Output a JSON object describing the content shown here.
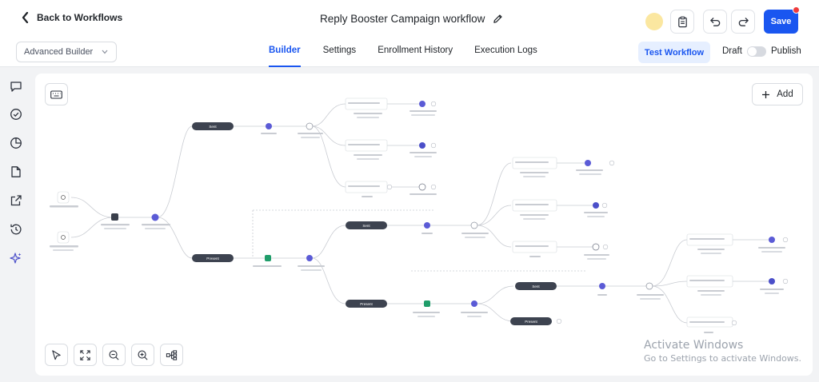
{
  "header": {
    "back_label": "Back to Workflows",
    "workflow_title": "Reply Booster Campaign workflow",
    "save_label": "Save"
  },
  "subbar": {
    "mode": "Advanced Builder",
    "tabs": [
      "Builder",
      "Settings",
      "Enrollment History",
      "Execution Logs"
    ],
    "active_tab": "Builder",
    "test_label": "Test Workflow",
    "draft_label": "Draft",
    "publish_label": "Publish",
    "publish_on": false
  },
  "rail": {
    "icons": [
      "chat-icon",
      "check-circle-icon",
      "pie-chart-icon",
      "file-icon",
      "external-link-icon",
      "history-icon",
      "sparkle-icon"
    ]
  },
  "canvas": {
    "add_label": "Add",
    "branch_labels": {
      "sent": "Sent",
      "present": "Present"
    },
    "tools": [
      "pointer-icon",
      "fit-view-icon",
      "zoom-out-icon",
      "zoom-in-icon",
      "auto-layout-icon"
    ]
  },
  "watermark": {
    "title": "Activate Windows",
    "subtitle": "Go to Settings to activate Windows."
  },
  "colors": {
    "accent": "#1a56f0",
    "branch_pill": "#3d4350",
    "node_purple": "#5b5bd6",
    "node_green": "#1f9d6a"
  }
}
